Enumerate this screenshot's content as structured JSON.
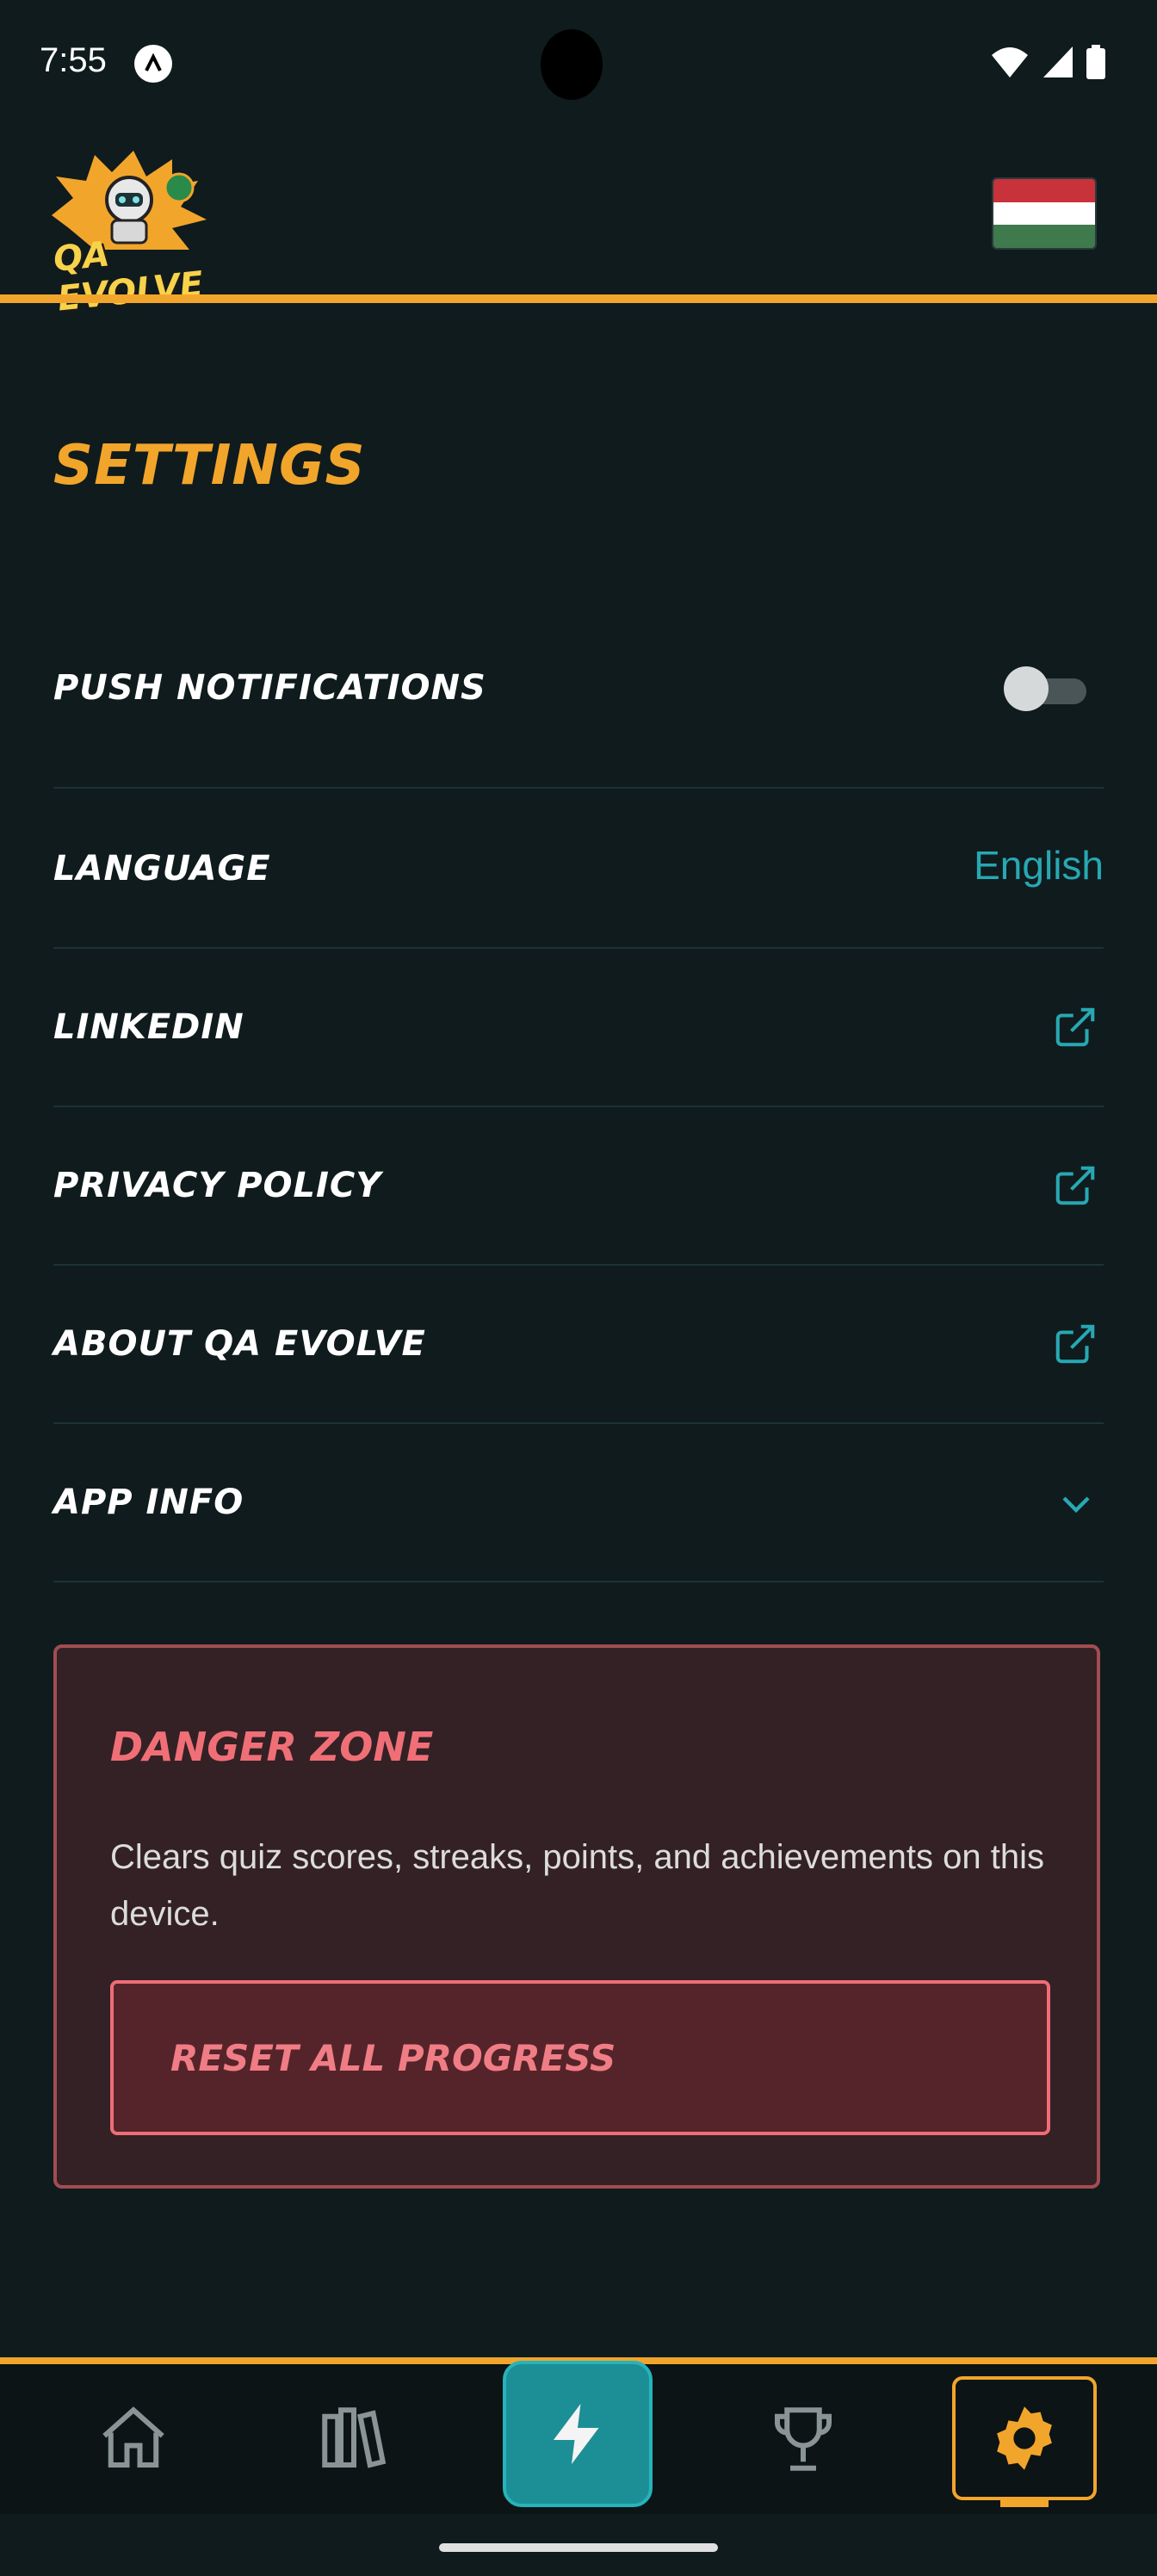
{
  "status_bar": {
    "time": "7:55"
  },
  "header": {
    "logo_text": "QA EVOLVE",
    "flag_colors": [
      "#c8323a",
      "#ffffff",
      "#3f7a4d"
    ]
  },
  "page": {
    "title": "SETTINGS"
  },
  "settings": {
    "push_notifications": {
      "label": "PUSH NOTIFICATIONS",
      "enabled": false
    },
    "language": {
      "label": "LANGUAGE",
      "value": "English"
    },
    "linkedin": {
      "label": "LINKEDIN"
    },
    "privacy_policy": {
      "label": "PRIVACY POLICY"
    },
    "about": {
      "label": "ABOUT QA EVOLVE"
    },
    "app_info": {
      "label": "APP INFO"
    }
  },
  "danger_zone": {
    "title": "DANGER ZONE",
    "description": "Clears quiz scores, streaks, points, and achievements on this device.",
    "reset_button": "RESET ALL PROGRESS"
  },
  "bottom_nav": {
    "items": [
      {
        "icon": "home-icon"
      },
      {
        "icon": "library-icon"
      },
      {
        "icon": "lightning-icon"
      },
      {
        "icon": "trophy-icon"
      },
      {
        "icon": "gear-icon",
        "active": true
      }
    ]
  },
  "colors": {
    "accent": "#f2a52b",
    "teal": "#27a8b3",
    "danger": "#f06f77",
    "background": "#0f1b1d"
  }
}
